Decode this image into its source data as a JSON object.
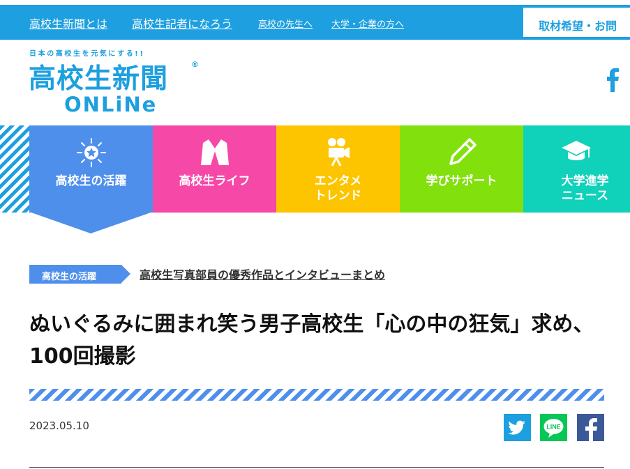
{
  "top_nav": {
    "links": [
      {
        "label": "高校生新聞とは"
      },
      {
        "label": "高校生記者になろう"
      },
      {
        "label": "高校の先生へ"
      },
      {
        "label": "大学・企業の方へ"
      }
    ],
    "contact_label": "取材希望・お問"
  },
  "logo": {
    "tagline": "日本の高校生を元気にする!!",
    "main": "高校生新聞",
    "reg": "®",
    "sub": "ONLiNe"
  },
  "categories": [
    {
      "line1": "高校生の活躍",
      "line2": "",
      "color": "#4f8fec",
      "icon": "star-burst-icon"
    },
    {
      "line1": "高校生ライフ",
      "line2": "",
      "color": "#f648a7",
      "icon": "blazer-icon"
    },
    {
      "line1": "エンタメ",
      "line2": "トレンド",
      "color": "#fdc500",
      "icon": "movie-camera-icon"
    },
    {
      "line1": "学びサポート",
      "line2": "",
      "color": "#82e00d",
      "icon": "pencil-icon"
    },
    {
      "line1": "大学進学",
      "line2": "ニュース",
      "color": "#10d1b9",
      "icon": "graduation-cap-icon"
    }
  ],
  "breadcrumb": {
    "category": "高校生の活躍",
    "link": "高校生写真部員の優秀作品とインタビューまとめ"
  },
  "article": {
    "title": "ぬいぐるみに囲まれ笑う男子高校生「心の中の狂気」求め、100回撮影",
    "date": "2023.05.10"
  },
  "share": {
    "twitter_color": "#1d9fe0",
    "line_color": "#06c755",
    "line_label": "LINE",
    "facebook_color": "#3b5998"
  }
}
